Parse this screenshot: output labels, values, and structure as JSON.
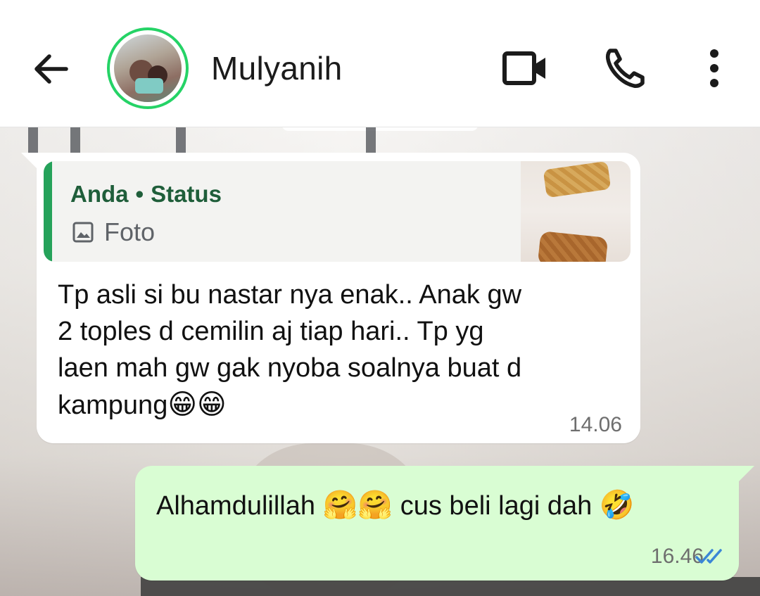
{
  "header": {
    "contact_name": "Mulyanih",
    "icons": [
      "arrow-back-icon",
      "contact-avatar",
      "video-call-icon",
      "phone-call-icon",
      "more-vertical-icon"
    ],
    "avatar_ring_color": "#25d366"
  },
  "messages": [
    {
      "direction": "incoming",
      "reply": {
        "author": "Anda",
        "separator": "•",
        "source": "Status",
        "type_label": "Foto",
        "type_icon": "photo-icon"
      },
      "text_lines": [
        "Tp asli si bu nastar nya enak.. Anak gw",
        "2 toples d cemilin aj tiap hari.. Tp yg",
        "laen mah gw gak nyoba soalnya buat d",
        "kampung"
      ],
      "emoji_tail": "😁😁",
      "time": "14.06"
    },
    {
      "direction": "outgoing",
      "text_part1": "Alhamdulillah ",
      "emoji1": "🤗🤗",
      "text_part2": " cus beli lagi dah ",
      "emoji2": "🤣",
      "time": "16.46",
      "status_icon": "double-check-read-icon",
      "read_color": "#3b86d6"
    }
  ],
  "colors": {
    "incoming_bubble": "#ffffff",
    "outgoing_bubble": "#d9fdd3",
    "quote_accent": "#25a25a",
    "quote_author": "#1f5e3a"
  }
}
